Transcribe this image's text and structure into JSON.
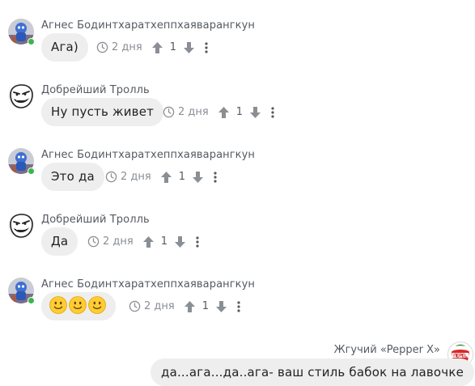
{
  "messages": [
    {
      "author": "Агнес Бодинтхаратхеппхаяварангкун",
      "text": "Ага)",
      "time": "2 дня",
      "likes": "1",
      "avatar_icon": "blue-character-avatar",
      "online": true
    },
    {
      "author": "Добрейший Тролль",
      "text": "Ну пусть живет",
      "time": "2 дня",
      "likes": "1",
      "avatar_icon": "troll-face-avatar",
      "online": false
    },
    {
      "author": "Агнес Бодинтхаратхеппхаяварангкун",
      "text": "Это да",
      "time": "2 дня",
      "likes": "1",
      "avatar_icon": "blue-character-avatar",
      "online": true
    },
    {
      "author": "Добрейший Тролль",
      "text": "Да",
      "time": "2 дня",
      "likes": "1",
      "avatar_icon": "troll-face-avatar",
      "online": false
    },
    {
      "author": "Агнес Бодинтхаратхеппхаяварангкун",
      "text": "",
      "emoji": [
        "slightly-smiling-face",
        "slightly-smiling-face",
        "slightly-smiling-face"
      ],
      "time": "2 дня",
      "likes": "1",
      "avatar_icon": "blue-character-avatar",
      "online": true
    }
  ],
  "own_message": {
    "author": "Жгучий «Pepper X»",
    "text": "да...ага...да..ага- ваш стиль бабок на лавочке",
    "avatar_icon": "perec-logo-avatar"
  },
  "colors": {
    "bubble": "#eeeeee",
    "online": "#3cb44b",
    "meta_icons": "#8a8f95"
  }
}
